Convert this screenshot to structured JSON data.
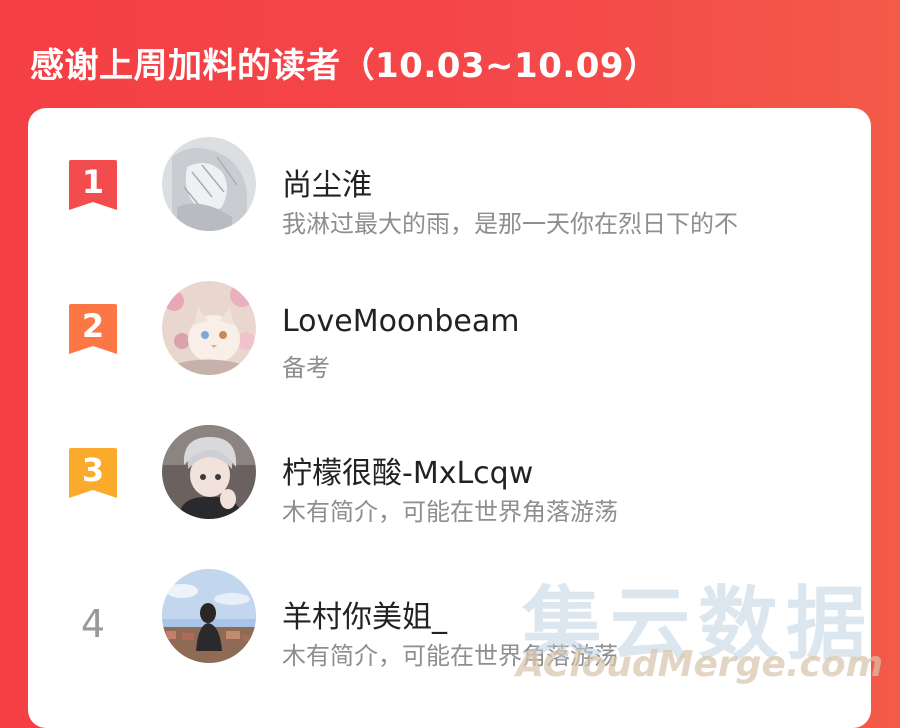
{
  "header": {
    "title": "感谢上周加料的读者（10.03~10.09）"
  },
  "colors": {
    "background": "#f4454a",
    "rank1": "#f24c4f",
    "rank2": "#fb7746",
    "rank3": "#fbaa2b",
    "rank_plain": "#999999",
    "name": "#222222",
    "bio": "#8e8e8e"
  },
  "readers": [
    {
      "rank": "1",
      "name": "尚尘淮",
      "bio": "我淋过最大的雨，是那一天你在烈日下的不",
      "avatar": "anime-sketch-avatar"
    },
    {
      "rank": "2",
      "name": "LoveMoonbeam",
      "bio": "备考",
      "avatar": "cat-with-flowers-avatar"
    },
    {
      "rank": "3",
      "name": "柠檬很酸-MxLcqw",
      "bio": "木有简介，可能在世界角落游荡",
      "avatar": "anime-boy-avatar"
    },
    {
      "rank": "4",
      "name": "羊村你美姐_",
      "bio": "木有简介，可能在世界角落游荡",
      "avatar": "girl-cityscape-avatar"
    }
  ],
  "watermark": {
    "cn": "集云数据",
    "en": "ACloudMerge.com"
  }
}
